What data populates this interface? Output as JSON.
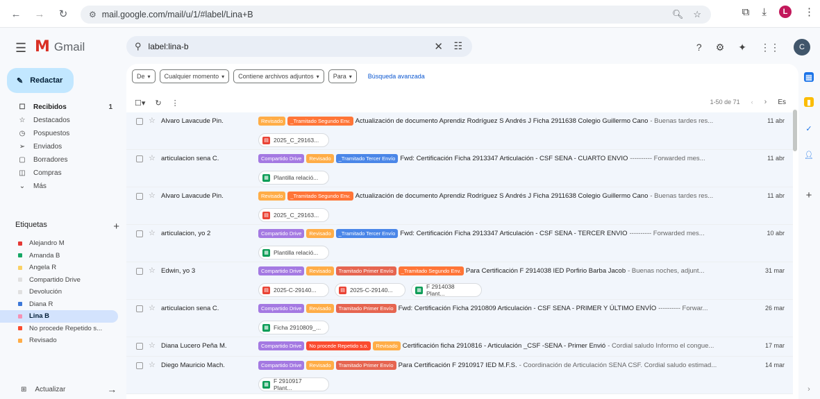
{
  "browser": {
    "url": "mail.google.com/mail/u/1/#label/Lina+B",
    "profile_initial": "L"
  },
  "app": {
    "name": "Gmail",
    "search_value": "label:lina-b",
    "account_initial": "C"
  },
  "sidebar": {
    "compose": "Redactar",
    "nav": [
      {
        "label": "Recibidos",
        "count": "1",
        "icon": "inbox-icon",
        "glyph": "☐",
        "bold": true
      },
      {
        "label": "Destacados",
        "count": "",
        "icon": "star-icon",
        "glyph": "☆"
      },
      {
        "label": "Pospuestos",
        "count": "",
        "icon": "clock-icon",
        "glyph": "◷"
      },
      {
        "label": "Enviados",
        "count": "",
        "icon": "send-icon",
        "glyph": "➢"
      },
      {
        "label": "Borradores",
        "count": "",
        "icon": "draft-icon",
        "glyph": "▢"
      },
      {
        "label": "Compras",
        "count": "",
        "icon": "shopping-icon",
        "glyph": "◫"
      },
      {
        "label": "Más",
        "count": "",
        "icon": "chevron-down-icon",
        "glyph": "⌄"
      }
    ],
    "labels_header": "Etiquetas",
    "labels": [
      {
        "label": "Alejandro M",
        "color": "#e53935"
      },
      {
        "label": "Amanda B",
        "color": "#16a765"
      },
      {
        "label": "Angela R",
        "color": "#fad165"
      },
      {
        "label": "Compartido Drive",
        "color": "#e0e0e0"
      },
      {
        "label": "Devolución",
        "color": "#e0e0e0"
      },
      {
        "label": "Diana R",
        "color": "#3c78d8"
      },
      {
        "label": "Lina B",
        "color": "#f691b3",
        "selected": true
      },
      {
        "label": "No procede Repetido s...",
        "color": "#fb4c2f"
      },
      {
        "label": "Revisado",
        "color": "#ffad47"
      }
    ],
    "update_label": "Actualizar"
  },
  "filters": {
    "chips": [
      "De",
      "Cualquier momento",
      "Contiene archivos adjuntos",
      "Para"
    ],
    "advanced": "Búsqueda avanzada"
  },
  "toolbar": {
    "page_info": "1-50 de 71",
    "lang": "Es"
  },
  "tag_colors": {
    "revisado": "#ffad47",
    "segundo": "#ff7537",
    "tercer": "#4a86e8",
    "drive": "#a479e2",
    "primer": "#e66550",
    "noprocede": "#fb4c2f"
  },
  "emails": [
    {
      "sender": "Alvaro Lavacude Pin.",
      "tags": [
        {
          "text": "Revisado",
          "kind": "revisado"
        },
        {
          "text": "_Tramitado Segundo Env.",
          "kind": "segundo"
        }
      ],
      "subject": "Actualización de documento Aprendiz Rodríguez S Andrés J Ficha 2911638 Colegio Guillermo Cano",
      "snippet": "- Buenas tardes res...",
      "date": "11 abr",
      "attachments": [
        {
          "name": "2025_C_29163...",
          "type": "pdf"
        }
      ]
    },
    {
      "sender": "articulacion sena C.",
      "tags": [
        {
          "text": "Compartido Drive",
          "kind": "drive"
        },
        {
          "text": "Revisado",
          "kind": "revisado"
        },
        {
          "text": "_Tramitado Tercer Envío",
          "kind": "tercer"
        }
      ],
      "subject": "Fwd: Certificación Ficha 2913347 Articulación - CSF SENA - CUARTO ENVIO",
      "snippet": "---------- Forwarded mes...",
      "date": "11 abr",
      "attachments": [
        {
          "name": "Plantilla relació...",
          "type": "sheet"
        }
      ]
    },
    {
      "sender": "Alvaro Lavacude Pin.",
      "tags": [
        {
          "text": "Revisado",
          "kind": "revisado"
        },
        {
          "text": "_Tramitado Segundo Env.",
          "kind": "segundo"
        }
      ],
      "subject": "Actualización de documento Aprendiz Rodríguez S Andrés J Ficha 2911638 Colegio Guillermo Cano",
      "snippet": "- Buenas tardes res...",
      "date": "11 abr",
      "attachments": [
        {
          "name": "2025_C_29163...",
          "type": "pdf"
        }
      ]
    },
    {
      "sender": "articulacion, yo 2",
      "tags": [
        {
          "text": "Compartido Drive",
          "kind": "drive"
        },
        {
          "text": "Revisado",
          "kind": "revisado"
        },
        {
          "text": "_Tramitado Tercer Envío",
          "kind": "tercer"
        }
      ],
      "subject": "Fwd: Certificación Ficha 2913347 Articulación - CSF SENA - TERCER ENVIO",
      "snippet": "---------- Forwarded mes...",
      "date": "10 abr",
      "attachments": [
        {
          "name": "Plantilla relació...",
          "type": "sheet"
        }
      ]
    },
    {
      "sender": "Edwin, yo 3",
      "tags": [
        {
          "text": "Compartido Drive",
          "kind": "drive"
        },
        {
          "text": "Revisado",
          "kind": "revisado"
        },
        {
          "text": "Tramitado Primer Envío",
          "kind": "primer"
        },
        {
          "text": "_Tramitado Segundo Env.",
          "kind": "segundo"
        }
      ],
      "subject": "Para Certificación F 2914038 IED Porfirio Barba Jacob",
      "snippet": "- Buenas noches, adjunt...",
      "date": "31 mar",
      "attachments": [
        {
          "name": "2025-C-29140...",
          "type": "pdf"
        },
        {
          "name": "2025-C-29140...",
          "type": "pdf"
        },
        {
          "name": "F 2914038 Plant...",
          "type": "sheet"
        }
      ]
    },
    {
      "sender": "articulacion sena C.",
      "tags": [
        {
          "text": "Compartido Drive",
          "kind": "drive"
        },
        {
          "text": "Revisado",
          "kind": "revisado"
        },
        {
          "text": "Tramitado Primer Envío",
          "kind": "primer"
        }
      ],
      "subject": "Fwd: Certificación Ficha 2910809 Articulación - CSF SENA - PRIMER Y ÚLTIMO ENVÍO",
      "snippet": "---------- Forwar...",
      "date": "26 mar",
      "attachments": [
        {
          "name": "Ficha 2910809_...",
          "type": "sheet"
        }
      ]
    },
    {
      "sender": "Diana Lucero Peña M.",
      "tags": [
        {
          "text": "Compartido Drive",
          "kind": "drive"
        },
        {
          "text": "No procede Repetido s.o.",
          "kind": "noprocede"
        },
        {
          "text": "Revisado",
          "kind": "revisado"
        }
      ],
      "subject": "Certificación ficha 2910816 - Articulación _CSF -SENA - Primer Envió",
      "snippet": "- Cordial saludo Informo el congue...",
      "date": "17 mar",
      "attachments": []
    },
    {
      "sender": "Diego Mauricio Mach.",
      "tags": [
        {
          "text": "Compartido Drive",
          "kind": "drive"
        },
        {
          "text": "Revisado",
          "kind": "revisado"
        },
        {
          "text": "Tramitado Primer Envío",
          "kind": "primer"
        }
      ],
      "subject": "Para Certificación F 2910917 IED M.F.S.",
      "snippet": "- Coordinación de Articulación SENA CSF. Cordial saludo estimad...",
      "date": "14 mar",
      "attachments": [
        {
          "name": "F 2910917 Plant...",
          "type": "sheet"
        }
      ]
    }
  ]
}
